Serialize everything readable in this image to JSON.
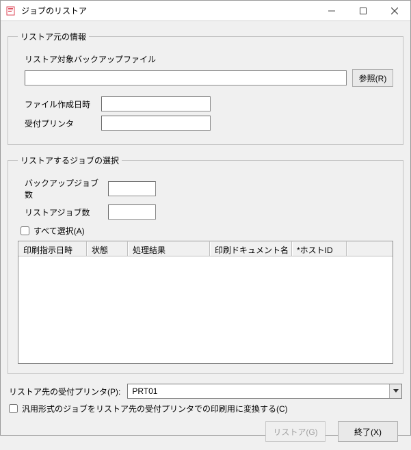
{
  "window": {
    "title": "ジョブのリストア"
  },
  "group_source": {
    "legend": "リストア元の情報",
    "backup_file_label": "リストア対象バックアップファイル",
    "backup_file_value": "",
    "browse_button": "参照(R)",
    "file_date_label": "ファイル作成日時",
    "file_date_value": "",
    "recv_printer_label": "受付プリンタ",
    "recv_printer_value": ""
  },
  "group_jobs": {
    "legend": "リストアするジョブの選択",
    "backup_count_label": "バックアップジョブ数",
    "backup_count_value": "",
    "restore_count_label": "リストアジョブ数",
    "restore_count_value": "",
    "select_all_label": "すべて選択(A)",
    "select_all_checked": false,
    "columns": {
      "c0": "印刷指示日時",
      "c1": "状態",
      "c2": "処理結果",
      "c3": "印刷ドキュメント名",
      "c4": "*ホストID"
    },
    "rows": []
  },
  "dest": {
    "label": "リストア先の受付プリンタ(P):",
    "value": "PRT01"
  },
  "convert_checkbox": {
    "label": "汎用形式のジョブをリストア先の受付プリンタでの印刷用に変換する(C)",
    "checked": false
  },
  "buttons": {
    "restore": "リストア(G)",
    "close": "終了(X)"
  }
}
